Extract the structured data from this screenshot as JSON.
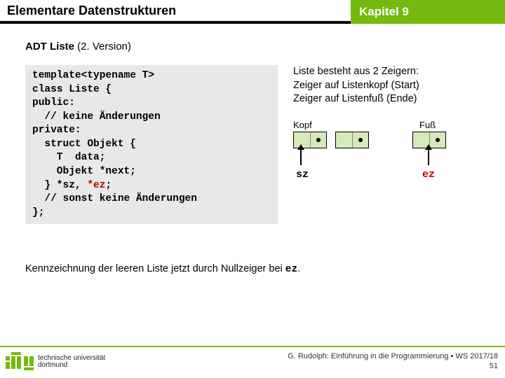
{
  "header": {
    "left": "Elementare Datenstrukturen",
    "right": "Kapitel 9"
  },
  "subtitle": {
    "main": "ADT Liste",
    "suffix": " (2. Version)"
  },
  "code": {
    "l1": "template<typename T>",
    "l2": "class Liste {",
    "l3": "public:",
    "l4": "  // keine Änderungen",
    "l5": "private:",
    "l6": "  struct Objekt {",
    "l7": "    T  data;",
    "l8": "    Objekt *next;",
    "l9a": "  } *sz, ",
    "l9b": "*ez",
    "l9c": ";",
    "l10": "  // sonst keine Änderungen",
    "l11": "};"
  },
  "desc": {
    "d1": "Liste besteht aus 2 Zeigern:",
    "d2": "Zeiger auf Listenkopf (Start)",
    "d3": "Zeiger auf Listenfuß (Ende)"
  },
  "diagram": {
    "kopf": "Kopf",
    "fuss": "Fuß",
    "sz": "sz",
    "ez": "ez"
  },
  "footnote": {
    "prefix": "Kennzeichnung der leeren Liste jetzt durch Nullzeiger bei ",
    "mono": "ez",
    "suffix": "."
  },
  "footer": {
    "uni1": "technische universität",
    "uni2": "dortmund",
    "credit": "G. Rudolph: Einführung in die Programmierung ▪ WS 2017/18",
    "page": "51"
  }
}
